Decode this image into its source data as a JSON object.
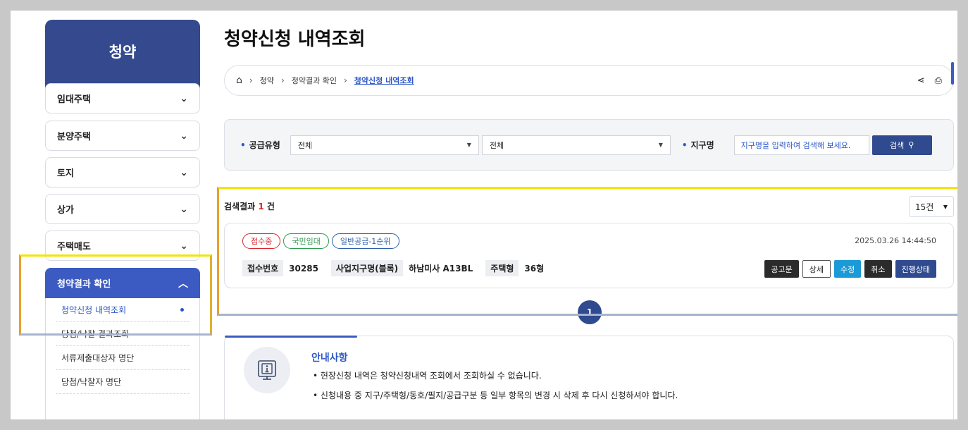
{
  "sidebar": {
    "title": "청약",
    "items": [
      {
        "label": "임대주택"
      },
      {
        "label": "분양주택"
      },
      {
        "label": "토지"
      },
      {
        "label": "상가"
      },
      {
        "label": "주택매도"
      },
      {
        "label": "청약결과 확인"
      }
    ],
    "subitems": [
      {
        "label": "청약신청 내역조회"
      },
      {
        "label": "당첨/낙찰 결과조회"
      },
      {
        "label": "서류제출대상자 명단"
      },
      {
        "label": "당첨/낙찰자 명단"
      }
    ]
  },
  "page": {
    "title": "청약신청 내역조회"
  },
  "breadcrumb": {
    "items": [
      "청약",
      "청약결과 확인"
    ],
    "current": "청약신청 내역조회"
  },
  "filter": {
    "supply_label": "공급유형",
    "select1": "전체",
    "select2": "전체",
    "district_label": "지구명",
    "search_placeholder": "지구명을 입력하여 검색해 보세요.",
    "search_button": "검색"
  },
  "results": {
    "label": "검색결과",
    "count": "1",
    "unit": "건",
    "per_page": "15건"
  },
  "card": {
    "badges": [
      "접수중",
      "국민임대",
      "일반공급-1순위"
    ],
    "timestamp": "2025.03.26 14:44:50",
    "fields": [
      {
        "label": "접수번호",
        "value": "30285"
      },
      {
        "label": "사업지구명(블록)",
        "value": "하남미사 A13BL"
      },
      {
        "label": "주택형",
        "value": "36형"
      }
    ],
    "actions": [
      "공고문",
      "상세",
      "수정",
      "취소",
      "진행상태"
    ]
  },
  "pagination": {
    "current": "1"
  },
  "notice": {
    "title": "안내사항",
    "lines": [
      "• 현장신청 내역은 청약신청내역 조회에서 조회하실 수 없습니다.",
      "• 신청내용 중 지구/주택형/동호/필지/공급구분 등 일부 항목의 변경 시 삭제 후 다시 신청하셔야 합니다."
    ]
  },
  "colors": {
    "brand": "#354a8e",
    "accent": "#2b56c6",
    "active": "#3c5bc2"
  }
}
